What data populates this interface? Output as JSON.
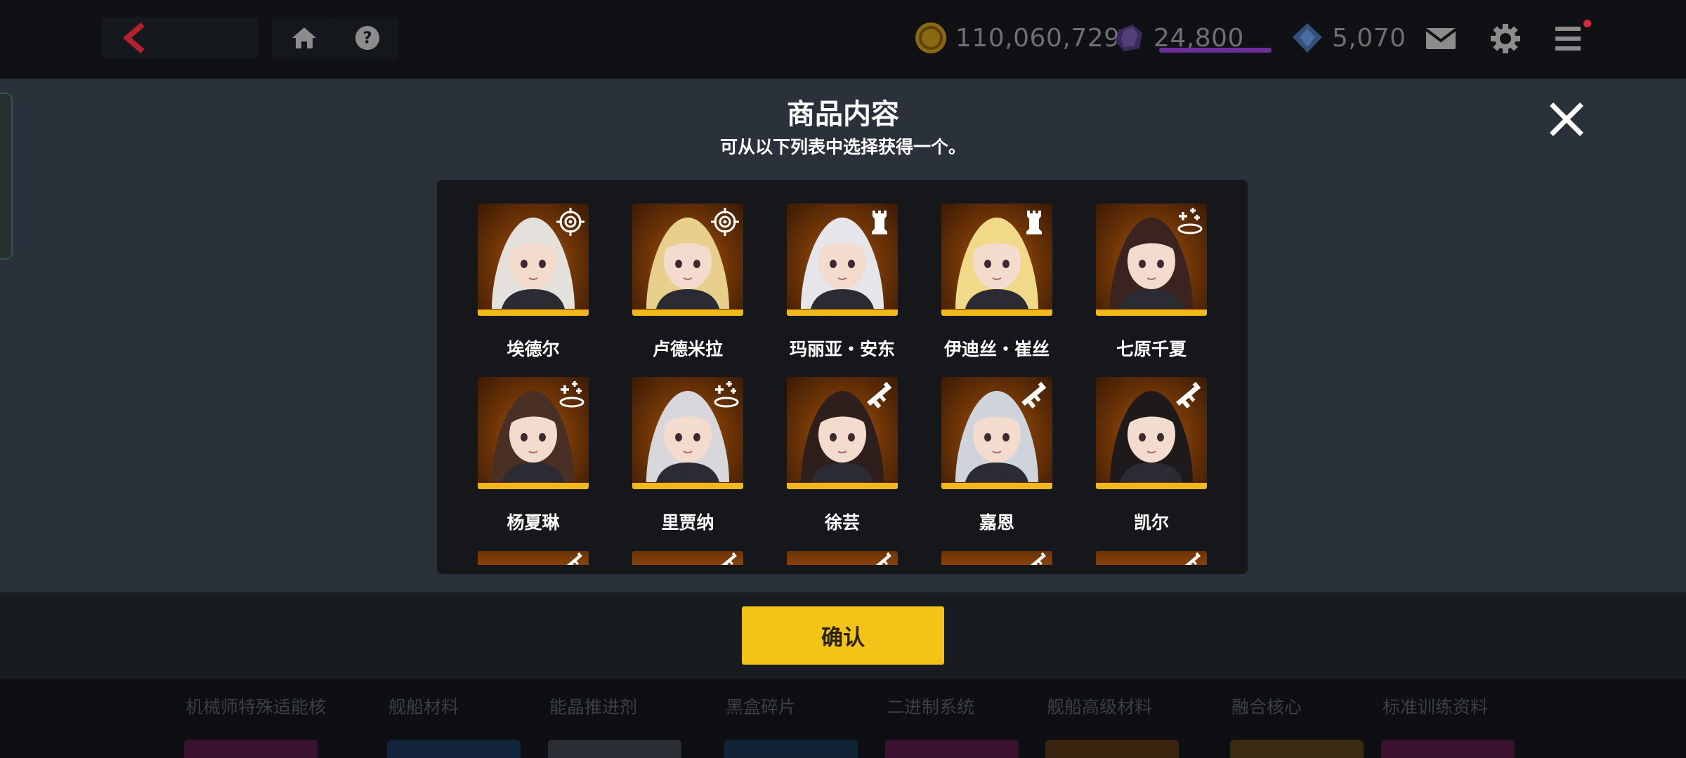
{
  "topbar": {
    "currencies": [
      {
        "name": "gold",
        "icon": "gold-coin-icon",
        "value": "110,060,729"
      },
      {
        "name": "purple-crystal",
        "icon": "purple-crystal-icon",
        "value": "24,800",
        "fill_fraction": 1.0
      },
      {
        "name": "diamond",
        "icon": "blue-diamond-icon",
        "value": "5,070"
      }
    ],
    "icons": [
      "back-arrow-icon",
      "home-icon",
      "help-icon",
      "mail-icon",
      "gear-icon",
      "menu-icon"
    ],
    "menu_has_notification": true
  },
  "dialog": {
    "title": "商品内容",
    "subtitle": "可从以下列表中选择获得一个。",
    "confirm_label": "确认",
    "characters": [
      {
        "name": "埃德尔",
        "role": "target-icon",
        "hair": "#e4e0dc"
      },
      {
        "name": "卢德米拉",
        "role": "target-icon",
        "hair": "#e8cf8c"
      },
      {
        "name": "玛丽亚・安东",
        "role": "rook-icon",
        "hair": "#e6e6ea"
      },
      {
        "name": "伊迪丝・崔丝",
        "role": "rook-icon",
        "hair": "#f1d98a"
      },
      {
        "name": "七原千夏",
        "role": "healer-icon",
        "hair": "#3b2420"
      },
      {
        "name": "杨夏琳",
        "role": "healer-icon",
        "hair": "#4a3024"
      },
      {
        "name": "里贾纳",
        "role": "healer-icon",
        "hair": "#d8d8dc"
      },
      {
        "name": "徐芸",
        "role": "rifle-icon",
        "hair": "#2f1f1c"
      },
      {
        "name": "嘉恩",
        "role": "rifle-icon",
        "hair": "#cfd4dc"
      },
      {
        "name": "凯尔",
        "role": "rifle-icon",
        "hair": "#1e1a1c"
      }
    ],
    "partial_row_icons": [
      "rifle-icon",
      "rifle-icon",
      "rifle-icon",
      "rifle-icon",
      "rifle-icon"
    ]
  },
  "bottom_tabs": [
    "机械师特殊适能核",
    "舰船材料",
    "能晶推进剂",
    "黑盒碎片",
    "二进制系统",
    "舰船高级材料",
    "融合核心",
    "标准训练资料"
  ],
  "colors": {
    "accent_yellow": "#f3c417",
    "card_underline": "#f2b71c",
    "overlay": "#2a313a",
    "back_arrow": "#b3202e"
  }
}
